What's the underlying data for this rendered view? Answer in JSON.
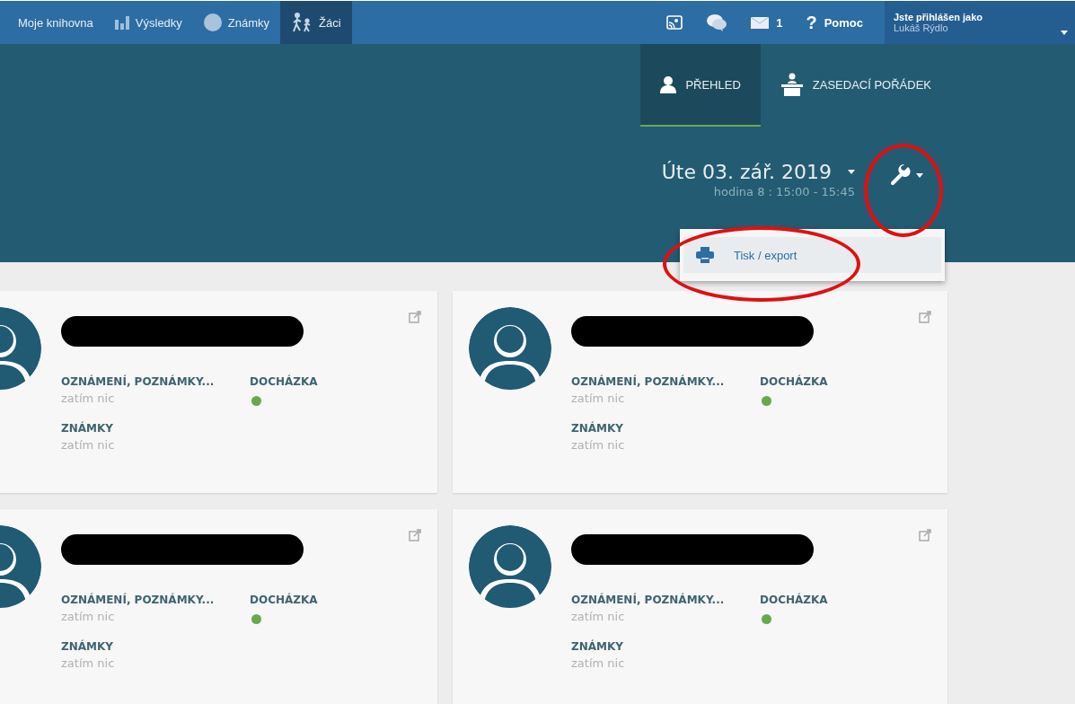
{
  "top_nav": {
    "items": [
      {
        "label": "Moje knihovna",
        "selected": false
      },
      {
        "label": "Výsledky",
        "selected": false
      },
      {
        "label": "Známky",
        "selected": false
      },
      {
        "label": "Žáci",
        "selected": true
      }
    ],
    "tools": [
      {
        "kind": "icon"
      },
      {
        "kind": "icon"
      },
      {
        "kind": "icon",
        "label": "1"
      },
      {
        "kind": "text",
        "symbol": "?",
        "label": "Pomoc"
      }
    ],
    "user": {
      "caption": "Jste přihlášen jako",
      "name": "Lukáš Rýdlo"
    }
  },
  "view_tabs": [
    {
      "label": "PŘEHLED",
      "selected": true
    },
    {
      "label": "ZASEDACÍ POŘÁDEK",
      "selected": false
    }
  ],
  "date": {
    "value": "Úte 03. zář. 2019",
    "lesson": "hodina 8 : 15:00 - 15:45"
  },
  "tools_menu": {
    "open": true,
    "items": [
      {
        "label": "Tisk / export"
      }
    ]
  },
  "students": [
    {
      "notes_label": "OZNÁMENÍ, POZNÁMKY...",
      "notes_value": "zatím nic",
      "attendance_label": "DOCHÁZKA",
      "grades_label": "ZNÁMKY",
      "grades_value": "zatím nic"
    },
    {
      "notes_label": "OZNÁMENÍ, POZNÁMKY...",
      "notes_value": "zatím nic",
      "attendance_label": "DOCHÁZKA",
      "grades_label": "ZNÁMKY",
      "grades_value": "zatím nic"
    },
    {
      "notes_label": "OZNÁMENÍ, POZNÁMKY...",
      "notes_value": "zatím nic",
      "attendance_label": "DOCHÁZKA",
      "grades_label": "ZNÁMKY",
      "grades_value": "zatím nic"
    },
    {
      "notes_label": "OZNÁMENÍ, POZNÁMKY...",
      "notes_value": "zatím nic",
      "attendance_label": "DOCHÁZKA",
      "grades_label": "ZNÁMKY",
      "grades_value": "zatím nic"
    }
  ]
}
